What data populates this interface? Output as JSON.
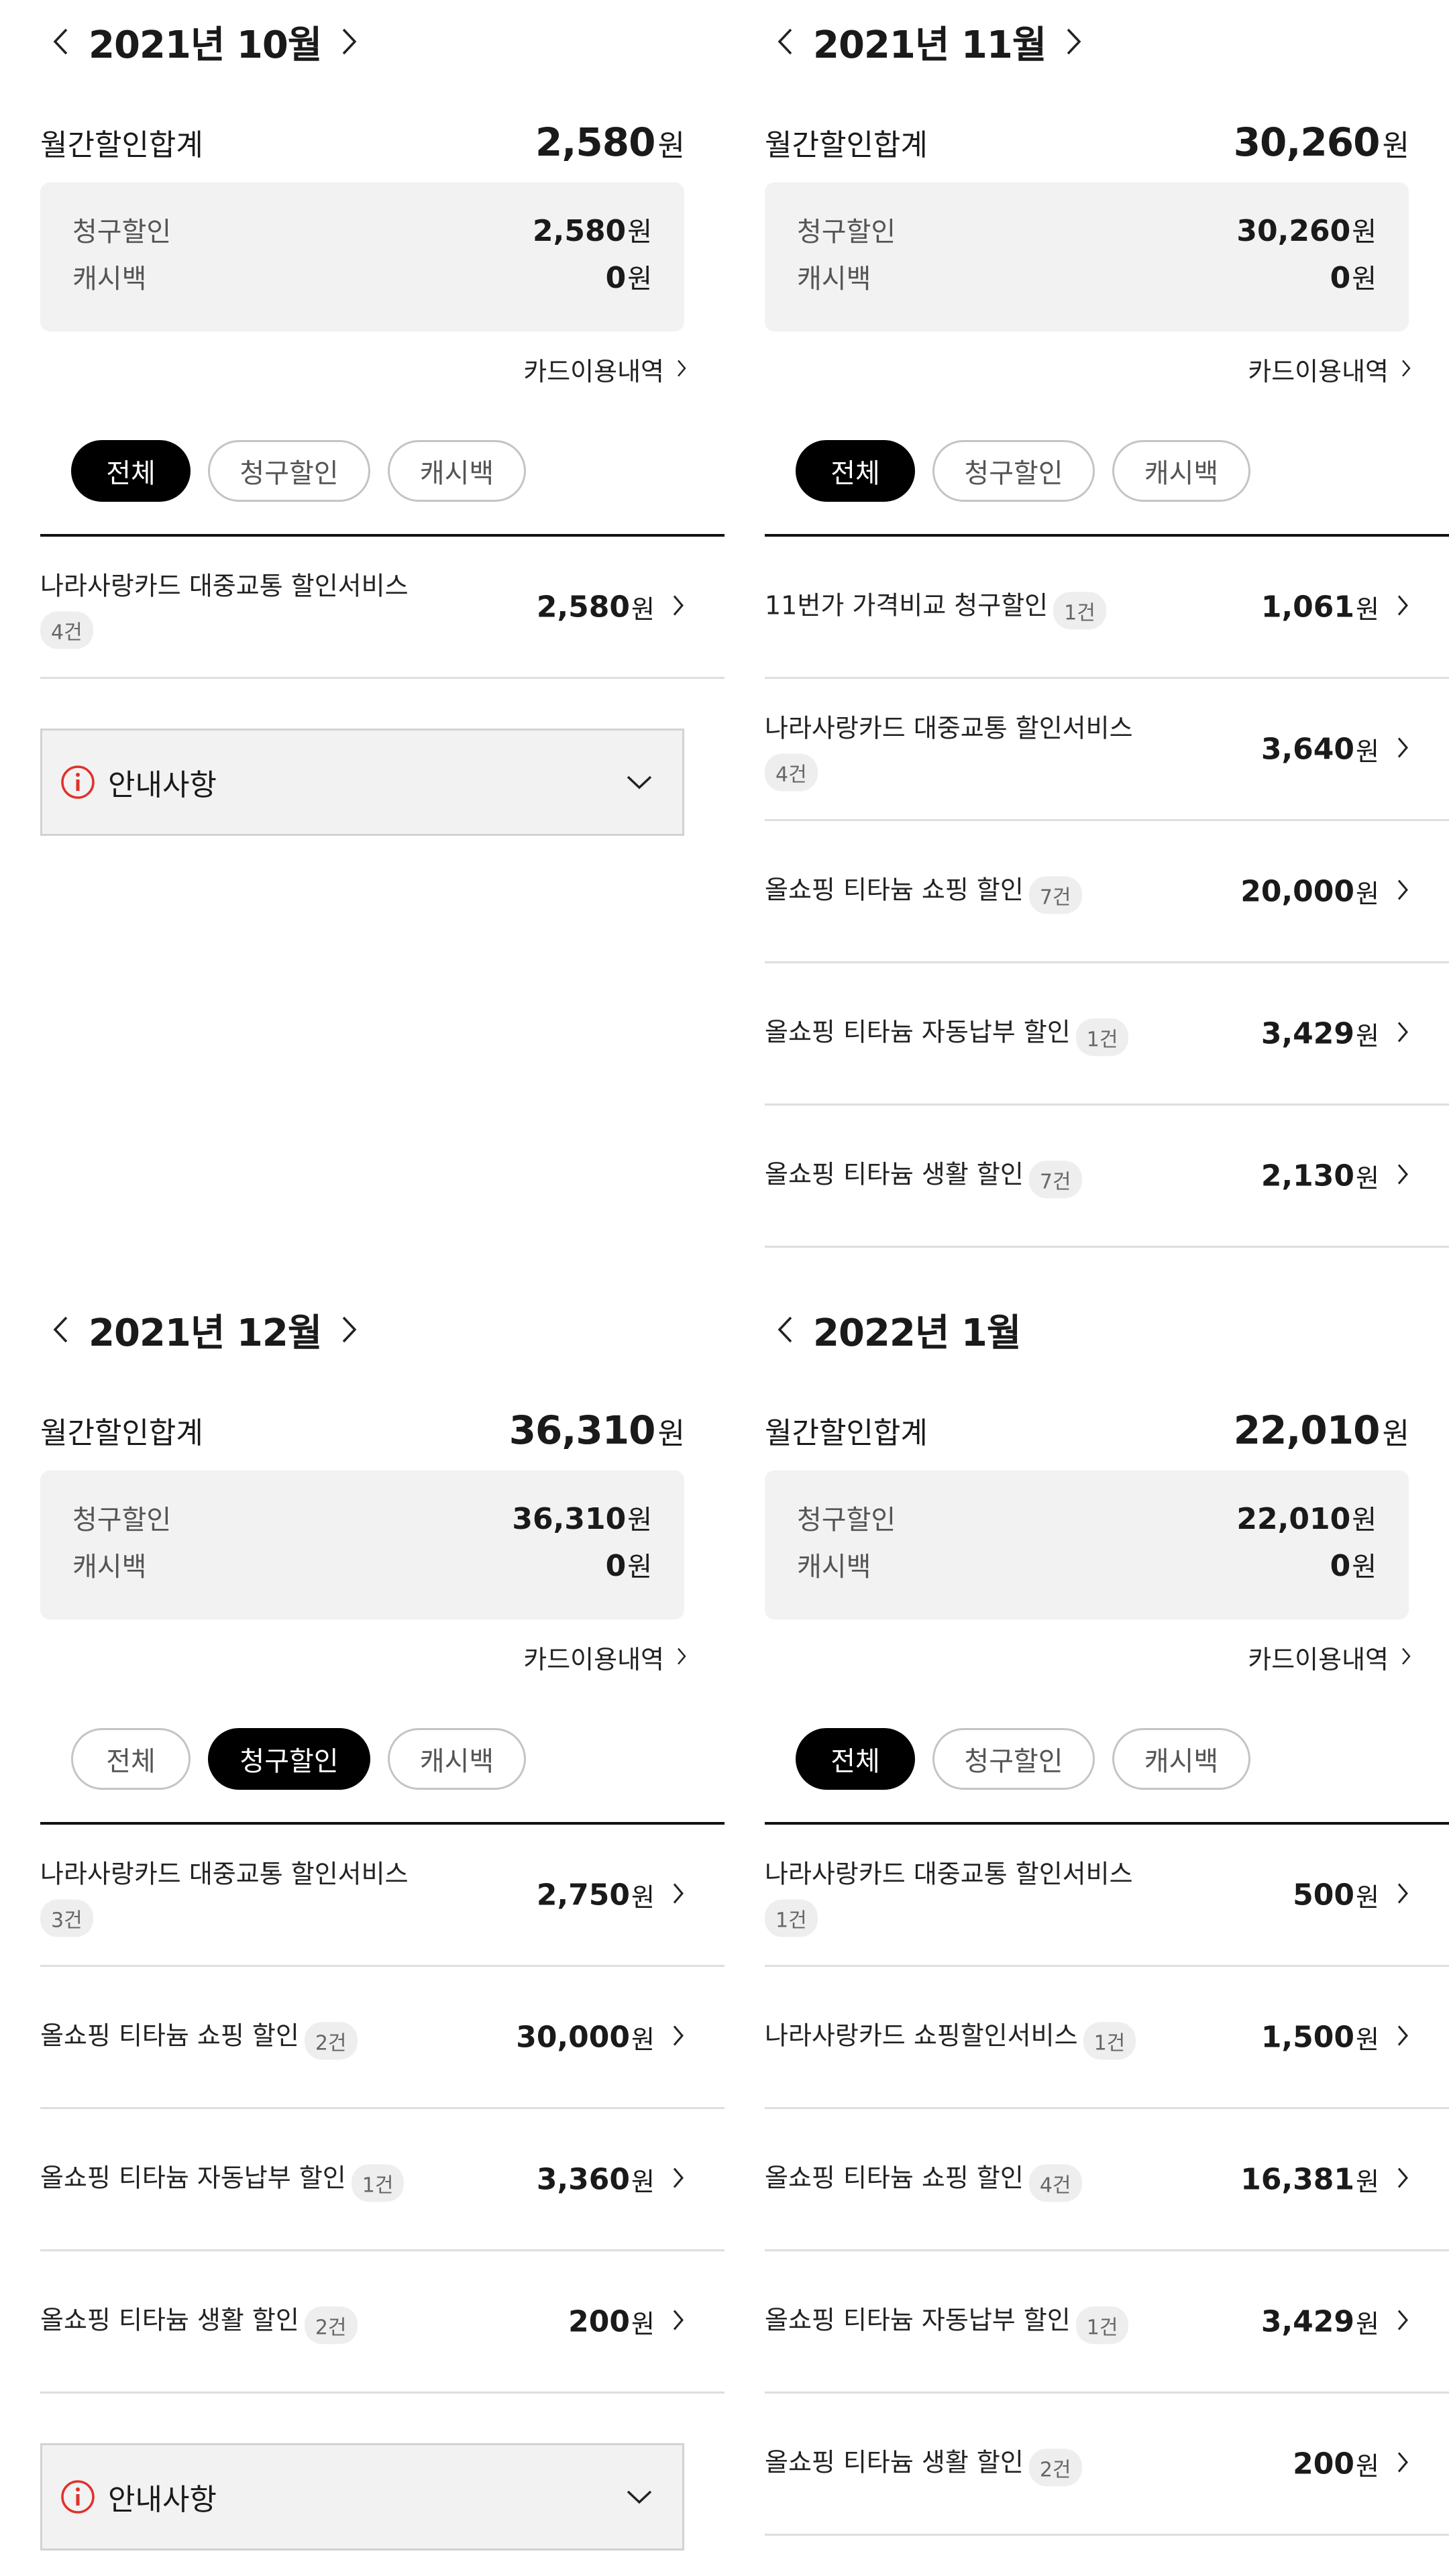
{
  "labels": {
    "monthly_total": "월간할인합계",
    "billing_discount": "청구할인",
    "cashback": "캐시백",
    "won": "원",
    "card_usage": "카드이용내역",
    "notice": "안내사항"
  },
  "filters": [
    "전체",
    "청구할인",
    "캐시백"
  ],
  "panels": [
    {
      "month": "2021년 10월",
      "total": "2,580",
      "billing": "2,580",
      "cashback": "0",
      "active_filter": 0,
      "items": [
        {
          "name": "나라사랑카드 대중교통 할인서비스",
          "count": "4건",
          "amount": "2,580"
        }
      ],
      "has_notice": true,
      "has_next": true
    },
    {
      "month": "2021년 11월",
      "total": "30,260",
      "billing": "30,260",
      "cashback": "0",
      "active_filter": 0,
      "items": [
        {
          "name": "11번가 가격비교 청구할인",
          "count": "1건",
          "amount": "1,061"
        },
        {
          "name": "나라사랑카드 대중교통 할인서비스",
          "count": "4건",
          "amount": "3,640"
        },
        {
          "name": "올쇼핑 티타늄 쇼핑 할인",
          "count": "7건",
          "amount": "20,000"
        },
        {
          "name": "올쇼핑 티타늄 자동납부 할인",
          "count": "1건",
          "amount": "3,429"
        },
        {
          "name": "올쇼핑 티타늄 생활 할인",
          "count": "7건",
          "amount": "2,130"
        }
      ],
      "has_notice": false,
      "has_next": true
    },
    {
      "month": "2021년 12월",
      "total": "36,310",
      "billing": "36,310",
      "cashback": "0",
      "active_filter": 1,
      "items": [
        {
          "name": "나라사랑카드 대중교통 할인서비스",
          "count": "3건",
          "amount": "2,750"
        },
        {
          "name": "올쇼핑 티타늄 쇼핑 할인",
          "count": "2건",
          "amount": "30,000"
        },
        {
          "name": "올쇼핑 티타늄 자동납부 할인",
          "count": "1건",
          "amount": "3,360"
        },
        {
          "name": "올쇼핑 티타늄 생활 할인",
          "count": "2건",
          "amount": "200"
        }
      ],
      "has_notice": true,
      "has_next": true
    },
    {
      "month": "2022년 1월",
      "total": "22,010",
      "billing": "22,010",
      "cashback": "0",
      "active_filter": 0,
      "items": [
        {
          "name": "나라사랑카드 대중교통 할인서비스",
          "count": "1건",
          "amount": "500"
        },
        {
          "name": "나라사랑카드 쇼핑할인서비스",
          "count": "1건",
          "amount": "1,500"
        },
        {
          "name": "올쇼핑 티타늄 쇼핑 할인",
          "count": "4건",
          "amount": "16,381"
        },
        {
          "name": "올쇼핑 티타늄 자동납부 할인",
          "count": "1건",
          "amount": "3,429"
        },
        {
          "name": "올쇼핑 티타늄 생활 할인",
          "count": "2건",
          "amount": "200"
        }
      ],
      "has_notice": false,
      "has_next": false
    }
  ]
}
